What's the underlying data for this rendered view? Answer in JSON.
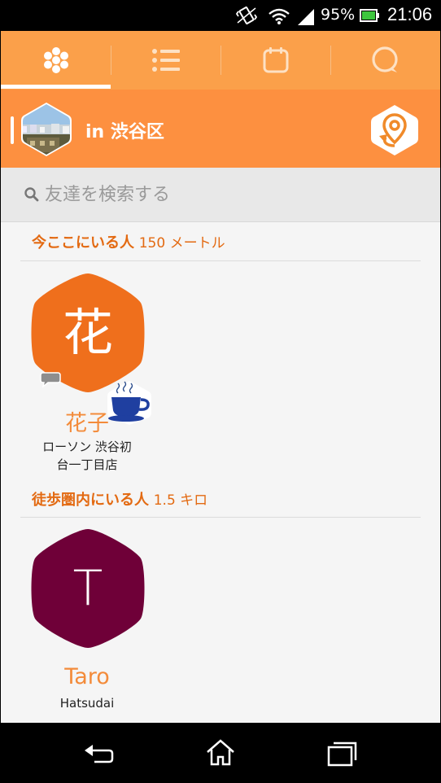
{
  "status_bar": {
    "battery_percent": "95%",
    "time": "21:06",
    "icons": [
      "vibrate-icon",
      "wifi-icon",
      "signal-icon",
      "battery-icon"
    ]
  },
  "tabs": [
    {
      "name": "hive",
      "icon": "hexagon-cluster-icon",
      "active": true
    },
    {
      "name": "list",
      "icon": "list-icon",
      "active": false
    },
    {
      "name": "calendar",
      "icon": "calendar-icon",
      "active": false
    },
    {
      "name": "chat",
      "icon": "chat-bubble-icon",
      "active": false
    }
  ],
  "location": {
    "title": "in 渋谷区",
    "button_icon": "location-pin-refresh-icon"
  },
  "search": {
    "placeholder": "友達を検索する"
  },
  "sections": [
    {
      "label": "今ここにいる人",
      "distance": "150 メートル",
      "people": [
        {
          "initial": "花",
          "name": "花子",
          "place_line1": "ローソン 渋谷初",
          "place_line2": "台一丁目店",
          "avatar_color": "#ef6f1c",
          "badges": [
            "chat-bubble-icon",
            "coffee-cup-icon"
          ]
        }
      ]
    },
    {
      "label": "徒歩圏内にいる人",
      "distance": "1.5 キロ",
      "people": [
        {
          "initial": "T",
          "name": "Taro",
          "place_line1": "Hatsudai",
          "avatar_color": "#6f0038"
        }
      ]
    }
  ],
  "nav": {
    "buttons": [
      "back-icon",
      "home-icon",
      "recent-apps-icon"
    ]
  },
  "colors": {
    "tab_bar": "#fba04a",
    "location_bar": "#fd9040",
    "accent_text": "#e36a12",
    "name_text": "#f38b3a"
  }
}
